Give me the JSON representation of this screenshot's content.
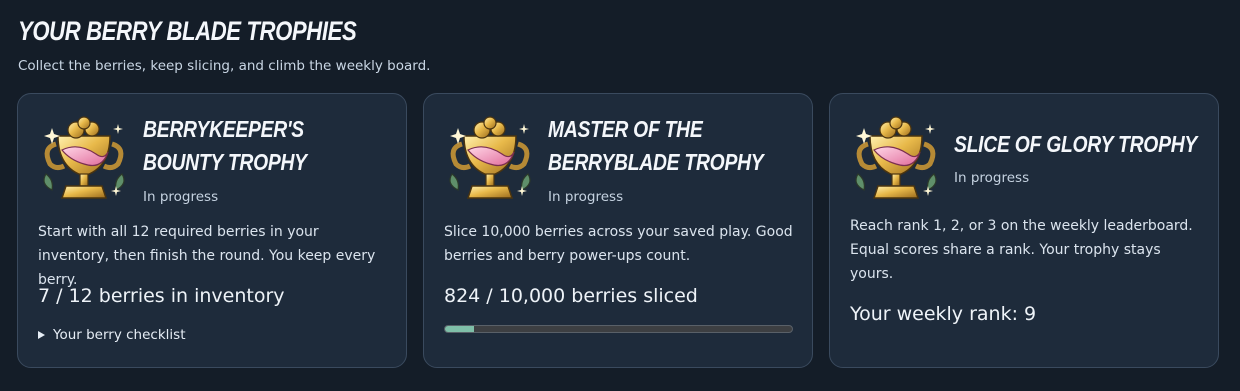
{
  "header": {
    "title": "YOUR BERRY BLADE TROPHIES",
    "subtitle": "Collect the berries, keep slicing, and climb the weekly board."
  },
  "cards": [
    {
      "title": "BERRYKEEPER'S BOUNTY TROPHY",
      "status": "In progress",
      "description": "Start with all 12 required berries in your inventory, then finish the round. You keep every berry.",
      "progress_text": "7 / 12 berries in inventory",
      "checklist_label": "Your berry checklist",
      "icon": "bounty-trophy-icon"
    },
    {
      "title": "MASTER OF THE BERRYBLADE TROPHY",
      "status": "In progress",
      "description": "Slice 10,000 berries across your saved play. Good berries and berry power-ups count.",
      "progress_text": "824 / 10,000 berries sliced",
      "progress_fraction": 0.0824,
      "icon": "master-trophy-icon"
    },
    {
      "title": "SLICE OF GLORY TROPHY",
      "status": "In progress",
      "description": "Reach rank 1, 2, or 3 on the weekly leaderboard. Equal scores share a rank. Your trophy stays yours.",
      "progress_text": "Your weekly rank: 9",
      "icon": "glory-trophy-icon"
    }
  ],
  "colors": {
    "background": "#141d28",
    "card": "#1e2b3b",
    "card_border": "#3a4a5e",
    "progress_fill": "#7fbfa8"
  }
}
